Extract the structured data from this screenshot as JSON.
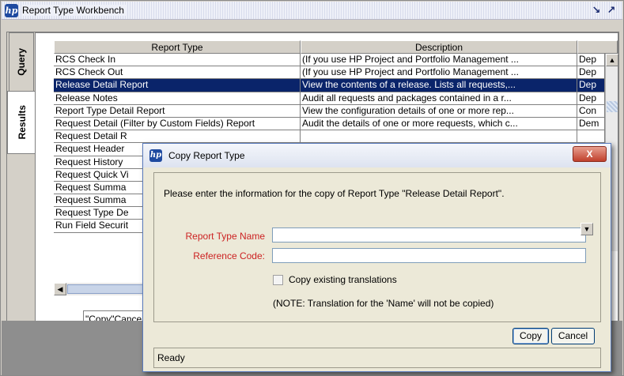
{
  "window": {
    "title": "Report Type Workbench",
    "logo_text": "hp"
  },
  "tabs": [
    {
      "label": "Query"
    },
    {
      "label": "Results"
    }
  ],
  "grid": {
    "columns": [
      "Report Type",
      "Description",
      ""
    ],
    "rows": [
      {
        "name": "RCS Check In",
        "description": "(If you use HP Project and Portfolio Management ...",
        "extra": "Dep"
      },
      {
        "name": "RCS Check Out",
        "description": "(If you use HP Project and Portfolio Management ...",
        "extra": "Dep"
      },
      {
        "name": "Release Detail Report",
        "description": "View the contents of a release. Lists all requests,...",
        "extra": "Dep"
      },
      {
        "name": "Release Notes",
        "description": "Audit all requests and packages contained in a r...",
        "extra": "Dep"
      },
      {
        "name": "Report Type Detail Report",
        "description": "View the configuration details of one or more rep...",
        "extra": "Con"
      },
      {
        "name": "Request Detail (Filter by Custom Fields) Report",
        "description": "Audit the details of one or more requests, which c...",
        "extra": "Dem"
      },
      {
        "name": "Request Detail R",
        "description": "",
        "extra": ""
      },
      {
        "name": "Request Header",
        "description": "",
        "extra": ""
      },
      {
        "name": "Request History",
        "description": "",
        "extra": ""
      },
      {
        "name": "Request Quick Vi",
        "description": "",
        "extra": ""
      },
      {
        "name": "Request Summa",
        "description": "",
        "extra": ""
      },
      {
        "name": "Request Summa",
        "description": "",
        "extra": ""
      },
      {
        "name": "Request Type De",
        "description": "",
        "extra": ""
      },
      {
        "name": "Run Field Securit",
        "description": "",
        "extra": ""
      }
    ],
    "selected_index": 2
  },
  "status_text": "\"Copy\"Cancelled",
  "dialog": {
    "title": "Copy Report Type",
    "close_label": "X",
    "message": "Please enter the information for the copy of Report Type \"Release Detail Report\".",
    "name_label": "Report Type Name",
    "name_value": "",
    "code_label": "Reference Code:",
    "code_value": "",
    "checkbox_label": "Copy existing translations",
    "note": "(NOTE: Translation for the 'Name' will not be copied)",
    "copy_label": "Copy",
    "cancel_label": "Cancel",
    "status": "Ready"
  }
}
